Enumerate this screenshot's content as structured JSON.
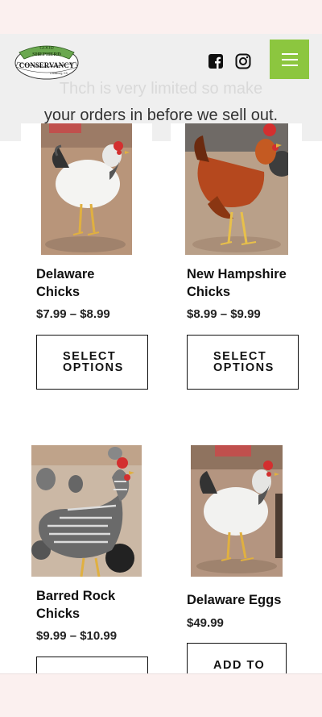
{
  "banner": {
    "line1_faded": "Th",
    "line1_mid": "ch is very limited so make",
    "line2": "your orders in before we sell out."
  },
  "logo": {
    "top": "GOOD",
    "middle": "SHEPHERD",
    "name": "CONSERVANCY",
    "place": "Lindsborg, KS"
  },
  "header": {
    "icons": [
      "facebook-icon",
      "instagram-icon",
      "hamburger-menu-icon"
    ],
    "accent_color": "#8cc63f"
  },
  "products": [
    {
      "name": "Delaware Chicks",
      "price": "$7.99 – $8.99",
      "button": "SELECT OPTIONS"
    },
    {
      "name": "New Hampshire Chicks",
      "price": "$8.99 – $9.99",
      "button": "SELECT OPTIONS"
    },
    {
      "name": "Barred Rock Chicks",
      "price": "$9.99 – $10.99",
      "button": ""
    },
    {
      "name": "Delaware Eggs",
      "price": "$49.99",
      "button": "ADD TO"
    }
  ]
}
